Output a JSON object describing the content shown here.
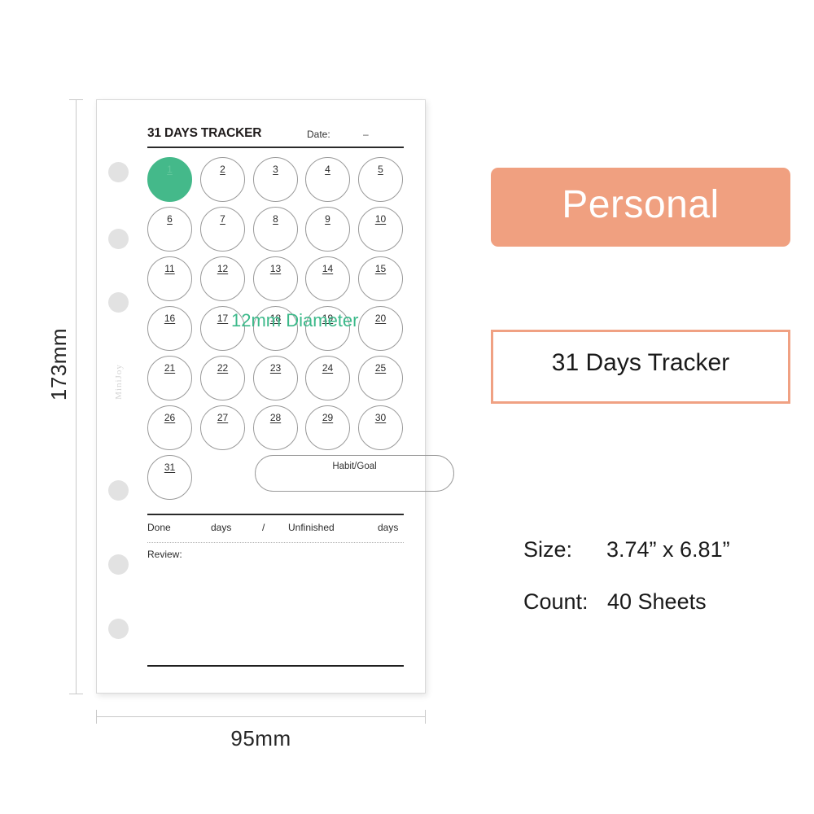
{
  "dimensions": {
    "height_label": "173mm",
    "width_label": "95mm"
  },
  "page": {
    "brand_watermark": "MiniJoy",
    "header": {
      "title": "31 DAYS TRACKER",
      "date_label": "Date:",
      "date_dash": "–"
    },
    "diameter_note": "12mm Diameter",
    "days": [
      "1",
      "2",
      "3",
      "4",
      "5",
      "6",
      "7",
      "8",
      "9",
      "10",
      "11",
      "12",
      "13",
      "14",
      "15",
      "16",
      "17",
      "18",
      "19",
      "20",
      "21",
      "22",
      "23",
      "24",
      "25",
      "26",
      "27",
      "28",
      "29",
      "30",
      "31"
    ],
    "filled_day": "1",
    "habit_label": "Habit/Goal",
    "summary": {
      "done": "Done",
      "days_1": "days",
      "slash": "/",
      "unfinished": "Unfinished",
      "days_2": "days"
    },
    "review_label": "Review:"
  },
  "info_panel": {
    "badge": {
      "label": "Personal",
      "background": "#f0a080",
      "text_color": "#ffffff"
    },
    "product_box": {
      "label": "31 Days Tracker",
      "border_color": "#f0a183"
    },
    "specs": [
      {
        "key": "Size:",
        "value": "3.74” x 6.81”"
      },
      {
        "key": "Count:",
        "value": "40 Sheets"
      }
    ]
  },
  "colors": {
    "accent_green": "#44b98a",
    "accent_salmon": "#f0a080",
    "hole_gray": "#e2e2e2"
  }
}
